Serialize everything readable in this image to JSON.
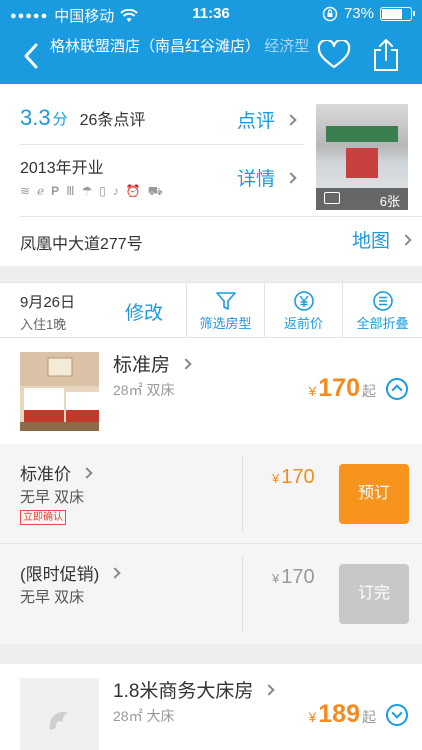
{
  "status_bar": {
    "signal_dots": "●●●●●",
    "carrier": "中国移动",
    "time": "11:36",
    "battery": "73%",
    "battery_level": 0.73
  },
  "nav": {
    "hotel_name": "格林联盟酒店（南昌红谷滩店）",
    "category": "经济型"
  },
  "info": {
    "score": "3.3",
    "score_unit": "分",
    "review_count": "26条点评",
    "review_link": "点评",
    "opened": "2013年开业",
    "details_link": "详情",
    "photo_count": "6张",
    "address": "凤凰中大道277号",
    "map_link": "地图"
  },
  "filter": {
    "date": "9月26日",
    "stay": "入住1晚",
    "modify": "修改",
    "tools": [
      {
        "label": "筛选房型",
        "icon": "funnel-icon"
      },
      {
        "label": "返前价",
        "icon": "yen-icon"
      },
      {
        "label": "全部折叠",
        "icon": "list-icon"
      }
    ]
  },
  "rooms": [
    {
      "name": "标准房",
      "spec": "28㎡  双床",
      "currency": "¥",
      "price": "170",
      "suffix": "起"
    },
    {
      "name": "1.8米商务大床房",
      "spec": "28㎡  大床",
      "currency": "¥",
      "price": "189",
      "suffix": "起"
    }
  ],
  "plans": [
    {
      "name": "标准价",
      "desc": "无早  双床",
      "tag": "立即确认",
      "currency": "¥",
      "price": "170",
      "button": "预订",
      "available": true
    },
    {
      "name": "(限时促销)",
      "desc": "无早  双床",
      "currency": "¥",
      "price": "170",
      "button": "订完",
      "available": false
    }
  ],
  "colors": {
    "accent": "#1a9be0",
    "price": "#f58a1f",
    "book": "#f7941d",
    "sold_out": "#c8c8c8"
  }
}
